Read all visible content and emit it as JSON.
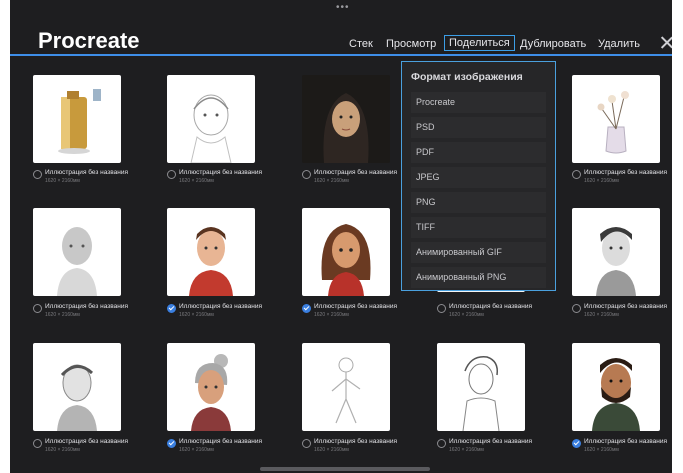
{
  "header": {
    "title": "Procreate",
    "nav": [
      {
        "label": "Стек",
        "active": false
      },
      {
        "label": "Просмотр",
        "active": false
      },
      {
        "label": "Поделиться",
        "active": true
      },
      {
        "label": "Дублировать",
        "active": false
      },
      {
        "label": "Удалить",
        "active": false
      }
    ],
    "close_icon": "close-icon",
    "top_dots": "•••"
  },
  "share_popover": {
    "title": "Формат изображения",
    "options": [
      "Procreate",
      "PSD",
      "PDF",
      "JPEG",
      "PNG",
      "TIFF",
      "Анимированный GIF",
      "Анимированный PNG"
    ]
  },
  "gallery": {
    "items": [
      {
        "title": "Иллюстрация без названия",
        "size": "1620 × 2160мм",
        "selected": false,
        "art": "battery"
      },
      {
        "title": "Иллюстрация без названия",
        "size": "1620 × 2160мм",
        "selected": false,
        "art": "sketch-girl"
      },
      {
        "title": "Иллюстрация без названия",
        "size": "1620 × 2160мм",
        "selected": false,
        "art": "dark-girl"
      },
      {
        "title": "",
        "size": "",
        "selected": false,
        "art": "hidden"
      },
      {
        "title": "Иллюстрация без названия",
        "size": "1620 × 2160мм",
        "selected": false,
        "art": "flowers"
      },
      {
        "title": "Иллюстрация без названия",
        "size": "1620 × 2160мм",
        "selected": false,
        "art": "gray-head"
      },
      {
        "title": "Иллюстрация без названия",
        "size": "1620 × 2160мм",
        "selected": true,
        "art": "man-red"
      },
      {
        "title": "Иллюстрация без названия",
        "size": "1620 × 2160мм",
        "selected": true,
        "art": "woman-brown"
      },
      {
        "title": "Иллюстрация без названия",
        "size": "1620 × 2160мм",
        "selected": false,
        "art": "hidden"
      },
      {
        "title": "Иллюстрация без названия",
        "size": "1620 × 2160мм",
        "selected": false,
        "art": "man-gray"
      },
      {
        "title": "Иллюстрация без названия",
        "size": "1620 × 2160мм",
        "selected": false,
        "art": "man-sketch"
      },
      {
        "title": "Иллюстрация без названия",
        "size": "1620 × 2160мм",
        "selected": true,
        "art": "old-woman"
      },
      {
        "title": "Иллюстрация без названия",
        "size": "1620 × 2160мм",
        "selected": false,
        "art": "figure-sketch"
      },
      {
        "title": "Иллюстрация без названия",
        "size": "1620 × 2160мм",
        "selected": false,
        "art": "boy-sketch"
      },
      {
        "title": "Иллюстрация без названия",
        "size": "1620 × 2160мм",
        "selected": true,
        "art": "bearded-man"
      }
    ]
  }
}
